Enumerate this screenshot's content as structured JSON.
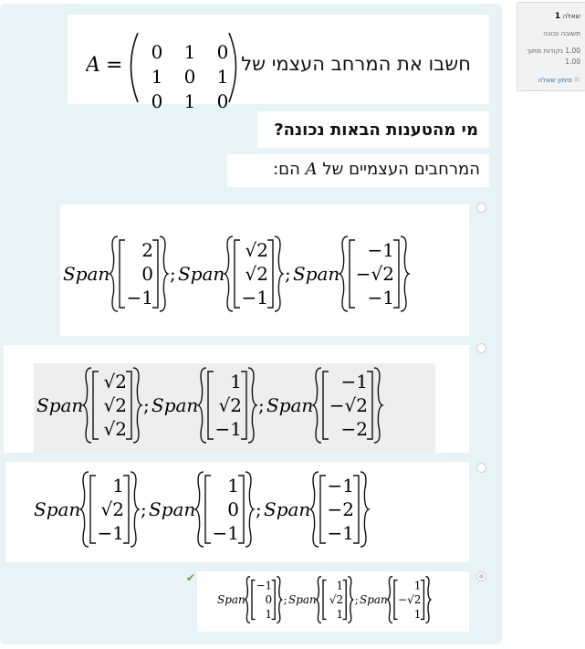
{
  "question_info": {
    "label": "שאלה",
    "number": "1",
    "status": "תשובה נכונה",
    "marks": "1.00 נקודות מתוך 1.00",
    "flag": "סימון שאלה"
  },
  "question": {
    "text": "חשבו את המרחב העצמי של",
    "matrix_name": "A",
    "matrix": [
      [
        "0",
        "1",
        "0"
      ],
      [
        "1",
        "0",
        "1"
      ],
      [
        "0",
        "1",
        "0"
      ]
    ],
    "prompt": "מי מהטענות הבאות נכונה?",
    "subprompt_pre": "המרחבים העצמיים של",
    "subprompt_var": "A",
    "subprompt_post": "הם:"
  },
  "options": [
    {
      "selected": false,
      "correct": false,
      "spans": [
        [
          "2",
          "0",
          "−1"
        ],
        [
          "√2",
          "√2",
          "−1"
        ],
        [
          "−1",
          "−√2",
          "−1"
        ]
      ]
    },
    {
      "selected": false,
      "correct": false,
      "spans": [
        [
          "√2",
          "√2",
          "√2"
        ],
        [
          "1",
          "√2",
          "−1"
        ],
        [
          "−1",
          "−√2",
          "−2"
        ]
      ]
    },
    {
      "selected": false,
      "correct": false,
      "spans": [
        [
          "1",
          "√2",
          "−1"
        ],
        [
          "1",
          "0",
          "−1"
        ],
        [
          "−1",
          "−2",
          "−1"
        ]
      ]
    },
    {
      "selected": true,
      "correct": true,
      "spans": [
        [
          "−1",
          "0",
          "1"
        ],
        [
          "1",
          "√2",
          "1"
        ],
        [
          "1",
          "−√2",
          "1"
        ]
      ]
    }
  ],
  "span_word": "Span",
  "separator": ";",
  "colors": {
    "panel": "#e7f3f5",
    "check": "#5fa83c",
    "option_highlight": "#eeeeee"
  }
}
